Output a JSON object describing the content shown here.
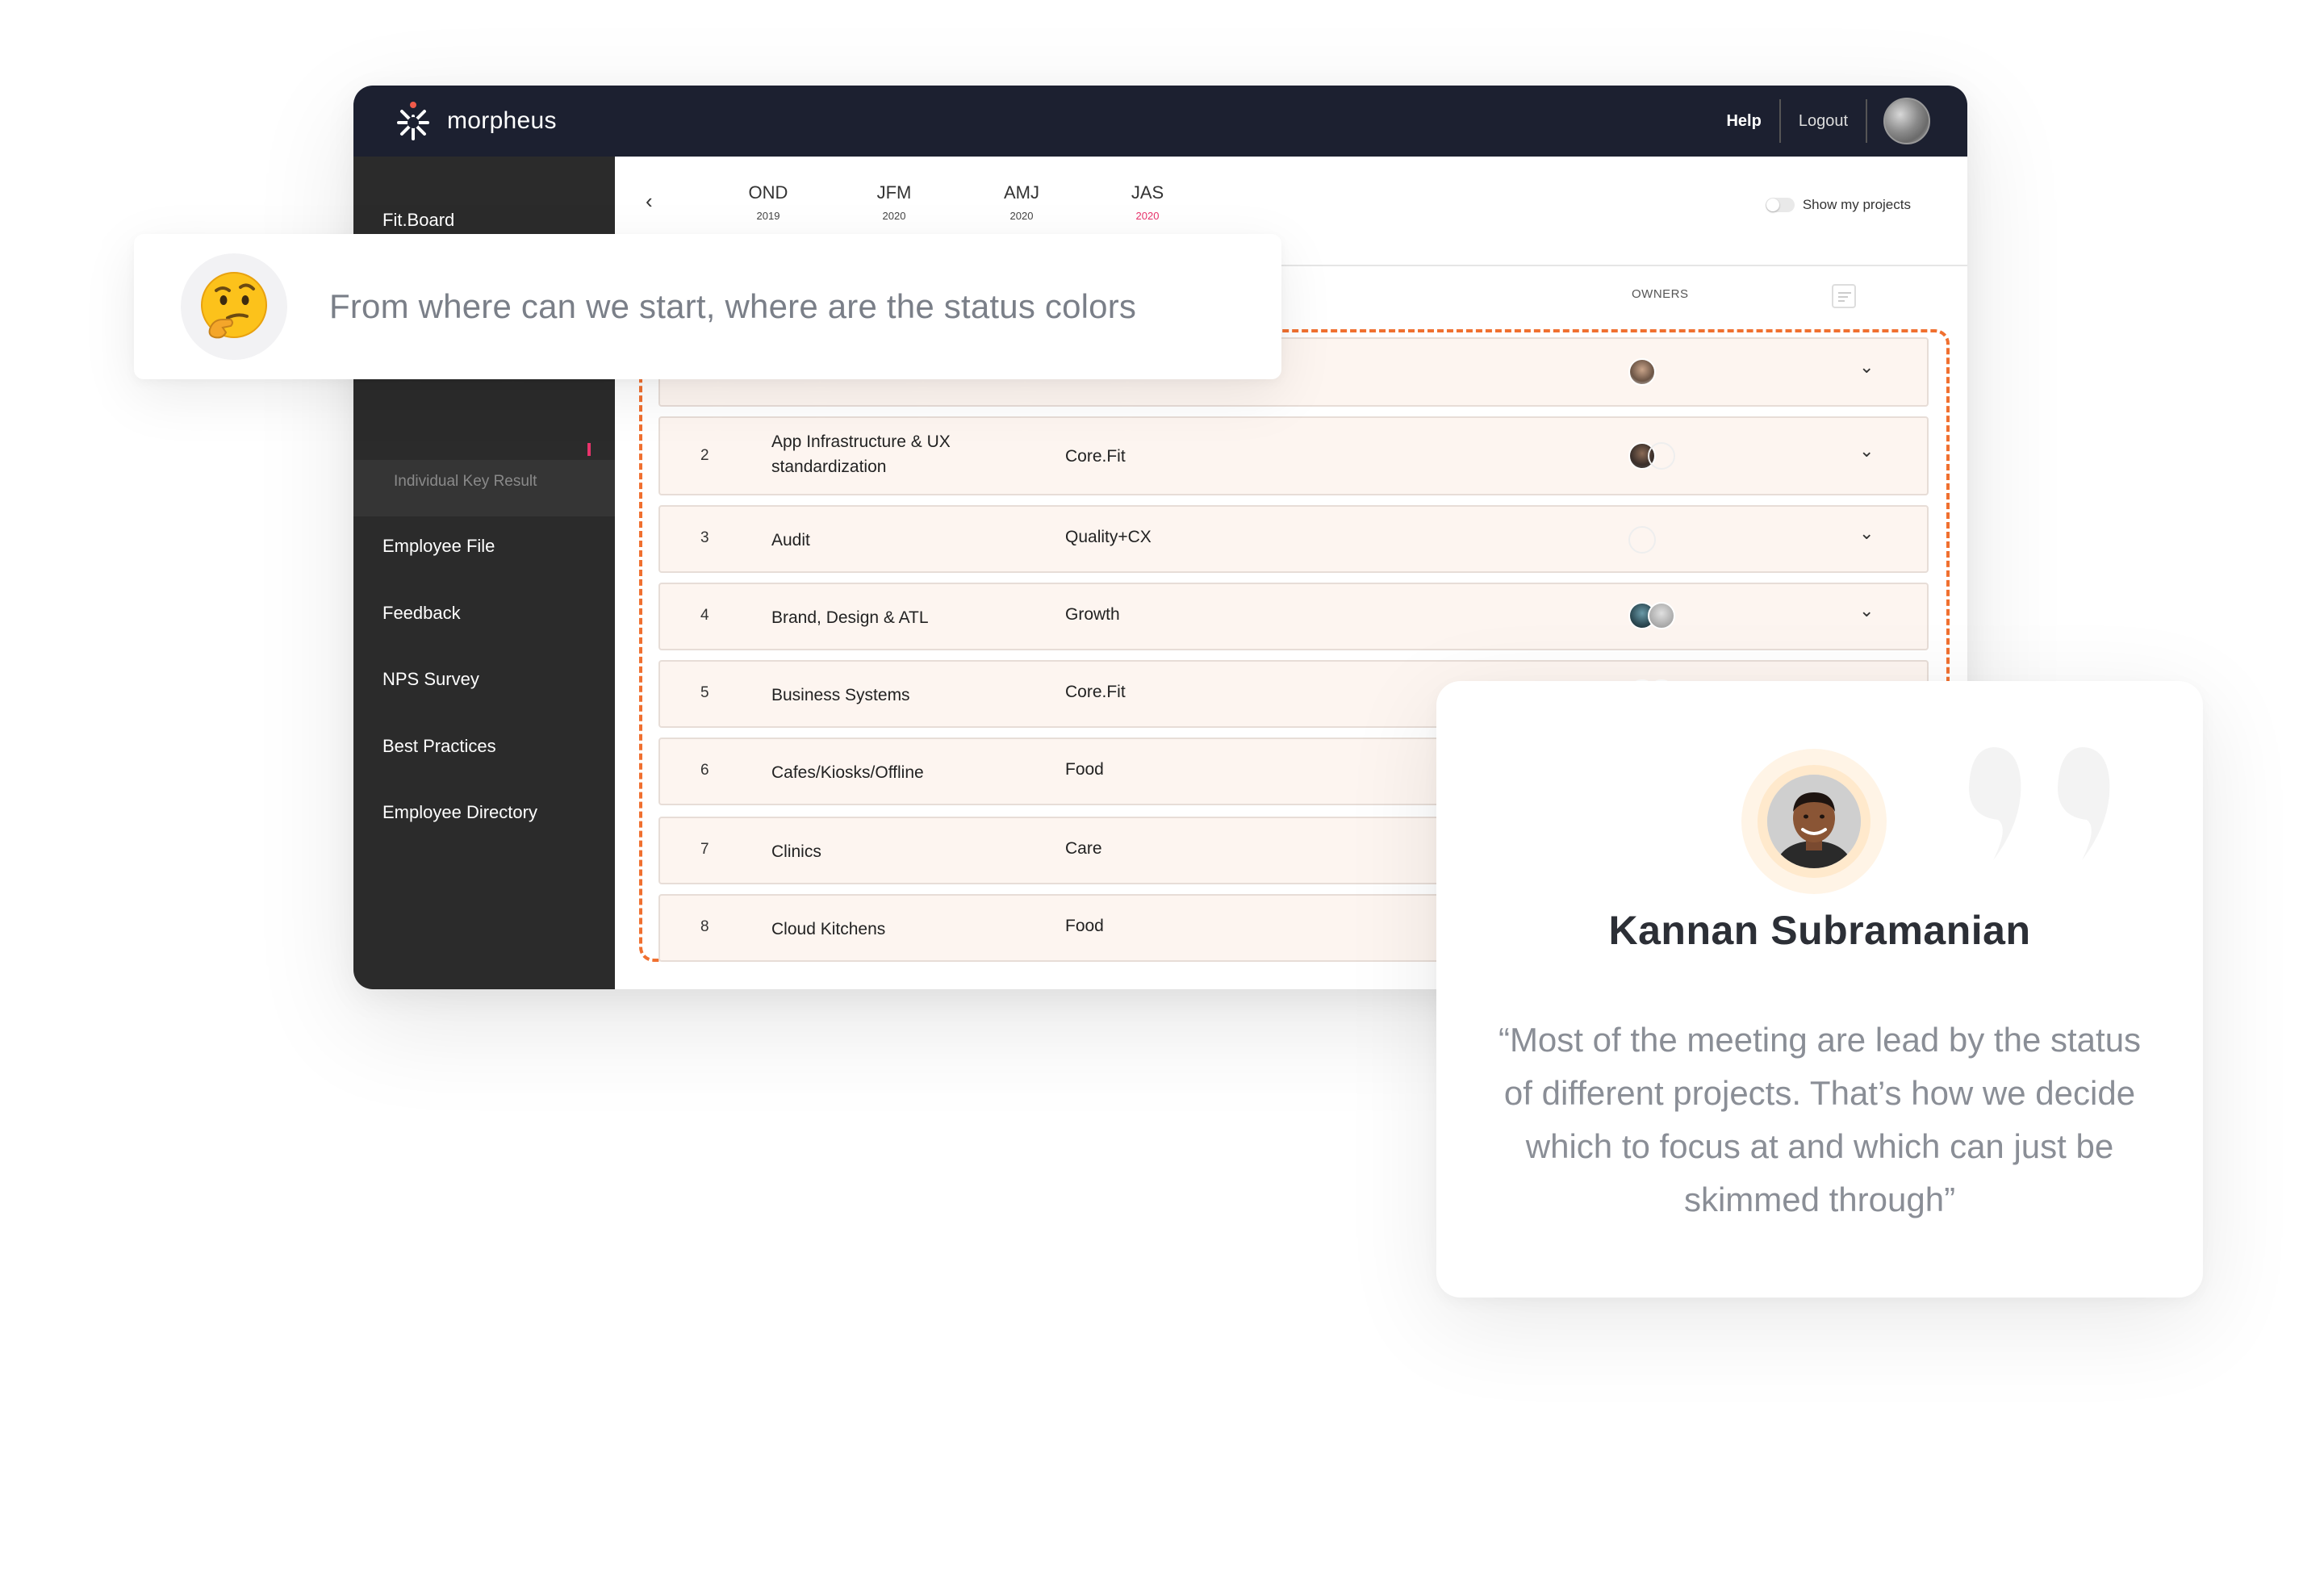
{
  "app": {
    "brand": "morpheus",
    "header": {
      "help": "Help",
      "logout": "Logout"
    },
    "sidebar": {
      "items": [
        {
          "label": "Fit.Board"
        },
        {
          "label": "Individual Key Result"
        },
        {
          "label": "Employee File"
        },
        {
          "label": "Feedback"
        },
        {
          "label": "NPS Survey"
        },
        {
          "label": "Best Practices"
        },
        {
          "label": "Employee Directory"
        }
      ]
    },
    "timeline": {
      "prev_icon": "‹",
      "quarters": [
        {
          "label": "OND",
          "year": "2019"
        },
        {
          "label": "JFM",
          "year": "2020"
        },
        {
          "label": "AMJ",
          "year": "2020"
        },
        {
          "label": "JAS",
          "year": "2020",
          "active": true
        }
      ],
      "toggle_label": "Show my projects"
    },
    "table": {
      "owners_header": "OWNERS",
      "rows": [
        {
          "num": "",
          "name": "",
          "team": ""
        },
        {
          "num": "2",
          "name": "App Infrastructure & UX standardization",
          "team": "Core.Fit"
        },
        {
          "num": "3",
          "name": "Audit",
          "team": "Quality+CX"
        },
        {
          "num": "4",
          "name": "Brand, Design & ATL",
          "team": "Growth"
        },
        {
          "num": "5",
          "name": "Business Systems",
          "team": "Core.Fit"
        },
        {
          "num": "6",
          "name": "Cafes/Kiosks/Offline",
          "team": "Food"
        },
        {
          "num": "7",
          "name": "Clinics",
          "team": "Care"
        },
        {
          "num": "8",
          "name": "Cloud Kitchens",
          "team": "Food"
        }
      ],
      "chevron": "⌄"
    }
  },
  "thinking": {
    "text": "From where can we start, where are the status colors",
    "icon": "thinking-face-icon"
  },
  "quote": {
    "name": "Kannan Subramanian",
    "text": "“Most of the meeting are lead by the status of different projects. That’s how we decide which to focus at and which can just be skimmed through”"
  },
  "colors": {
    "topbar": "#1c2030",
    "sidebar": "#2b2b2b",
    "accent_pink": "#e8336b",
    "dashed_orange": "#f07030",
    "row_bg": "#fdf5f0"
  }
}
